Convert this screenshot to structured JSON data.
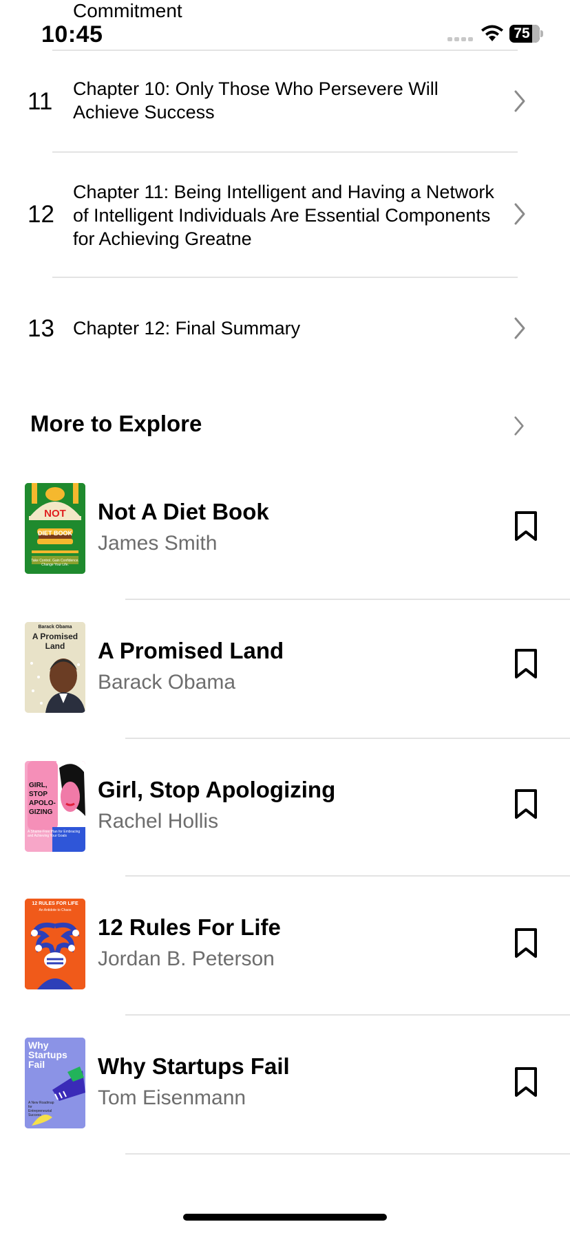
{
  "status_bar": {
    "title_fragment": "Commitment",
    "time": "10:45",
    "battery": "75"
  },
  "chapters": [
    {
      "number": "11",
      "title": "Chapter 10: Only Those Who Persevere Will Achieve Success"
    },
    {
      "number": "12",
      "title": "Chapter 11: Being Intelligent and Having a Network of Intelligent Individuals Are Essential Components for Achieving Greatne"
    },
    {
      "number": "13",
      "title": "Chapter 12: Final Summary"
    }
  ],
  "more_to_explore": {
    "title": "More to Explore",
    "books": [
      {
        "title": "Not A Diet Book",
        "author": "James Smith"
      },
      {
        "title": "A Promised Land",
        "author": "Barack Obama"
      },
      {
        "title": "Girl, Stop Apologizing",
        "author": "Rachel Hollis"
      },
      {
        "title": "12 Rules For Life",
        "author": "Jordan B. Peterson"
      },
      {
        "title": "Why Startups Fail",
        "author": "Tom Eisenmann"
      }
    ]
  },
  "covers": {
    "not_diet": {
      "top": "NOT",
      "mid": "DIET BOOK",
      "bottom": "Take Control. Gain Confidence. Change Your Life.",
      "bg": "#1f8a2e"
    },
    "promised_land": {
      "author": "Barack Obama",
      "line1": "A Promised",
      "line2": "Land",
      "bg": "#e8e2c8"
    },
    "girl_stop": {
      "line1": "GIRL,",
      "line2": "STOP",
      "line3": "APOLO-",
      "line4": "GIZING",
      "sub": "A Shame-Free Plan for Embracing and Achieving Your Goals",
      "bg": "#f7a6c8"
    },
    "twelve_rules": {
      "top": "12 RULES FOR LIFE",
      "sub": "An Antidote to Chaos",
      "bg": "#f05a1a"
    },
    "why_startups": {
      "line1": "Why",
      "line2": "Startups",
      "line3": "Fail",
      "sub": "A New Roadmap for Entrepreneurial Success",
      "bg": "#8b93e6"
    }
  }
}
